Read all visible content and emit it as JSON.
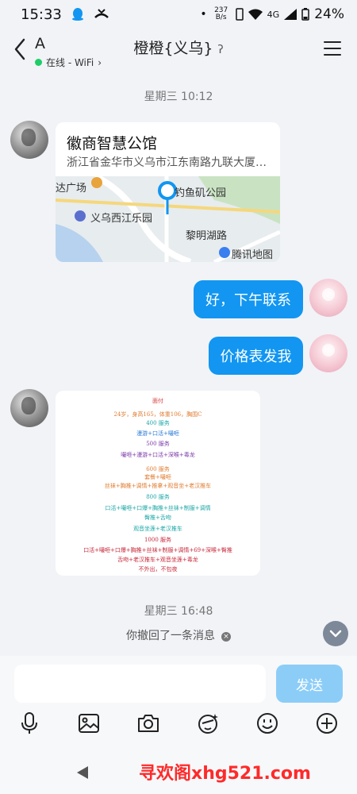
{
  "status_bar": {
    "time": "15:33",
    "speed": "237 B/s",
    "network": "4G",
    "battery": "24%"
  },
  "header": {
    "contact_short": "A",
    "status": "在线 - WiFi",
    "title": "橙橙{义乌}"
  },
  "chat": {
    "time_1": "星期三 10:12",
    "location": {
      "name": "徽商智慧公馆",
      "address": "浙江省金华市义乌市江东南路九联大厦…",
      "map_labels": {
        "top_left": "达广场",
        "park": "钓鱼矶公园",
        "xijiang": "义乌西江乐园",
        "road": "黎明湖路",
        "provider": "腾讯地图"
      }
    },
    "messages_out": [
      "好，下午联系",
      "价格表发我"
    ],
    "price_card": [
      {
        "text": "面付",
        "color": "#d63a3a"
      },
      {
        "text": "24岁，身高165，体重106，胸围C",
        "color": "#e07b2f"
      },
      {
        "text": "400 服务",
        "color": "#1aa6a6"
      },
      {
        "text": "漫游+口活+嘬咂",
        "color": "#2b7bd6"
      },
      {
        "text": "500 服务",
        "color": "#7a3aa8"
      },
      {
        "text": "嘬咂+漫游+口活+深喉+毒龙",
        "color": "#7a3aa8"
      },
      {
        "text": "600 服务",
        "color": "#e07b2f"
      },
      {
        "text": "套餐+嘬咂",
        "color": "#e07b2f"
      },
      {
        "text": "丝袜+胸推+调情+推拿+观音坐+老汉推车",
        "color": "#e07b2f"
      },
      {
        "text": "800 服务",
        "color": "#1aa6a6"
      },
      {
        "text": "口活+嘬咂+口爆+胸推+丝袜+制服+调情",
        "color": "#1aa6a6"
      },
      {
        "text": "臀推+舌吻",
        "color": "#1aa6a6"
      },
      {
        "text": "观音坐莲+老汉推车",
        "color": "#1aa6a6"
      },
      {
        "text": "1000 服务",
        "color": "#c8283a"
      },
      {
        "text": "口活+嘬咂+口爆+胸推+丝袜+制服+调情+69+深喉+臀推",
        "color": "#c8283a"
      },
      {
        "text": "舌吻+老汉推车+观音坐莲+毒龙",
        "color": "#c8283a"
      },
      {
        "text": "不外出，不包夜",
        "color": "#c8283a"
      }
    ],
    "time_2": "星期三 16:48",
    "recall_notice": "你撤回了一条消息"
  },
  "input": {
    "placeholder": "",
    "send_label": "发送"
  },
  "toolbar": {
    "icons": [
      "microphone-icon",
      "image-icon",
      "camera-icon",
      "sticker-icon",
      "emoji-icon",
      "plus-icon"
    ]
  },
  "watermark": "寻欢阁xhg521.com",
  "colors": {
    "bubble_out": "#1296f1",
    "send_button": "#8ccdf8",
    "online_dot": "#1ecd6a",
    "watermark": "#ff2a2a"
  }
}
